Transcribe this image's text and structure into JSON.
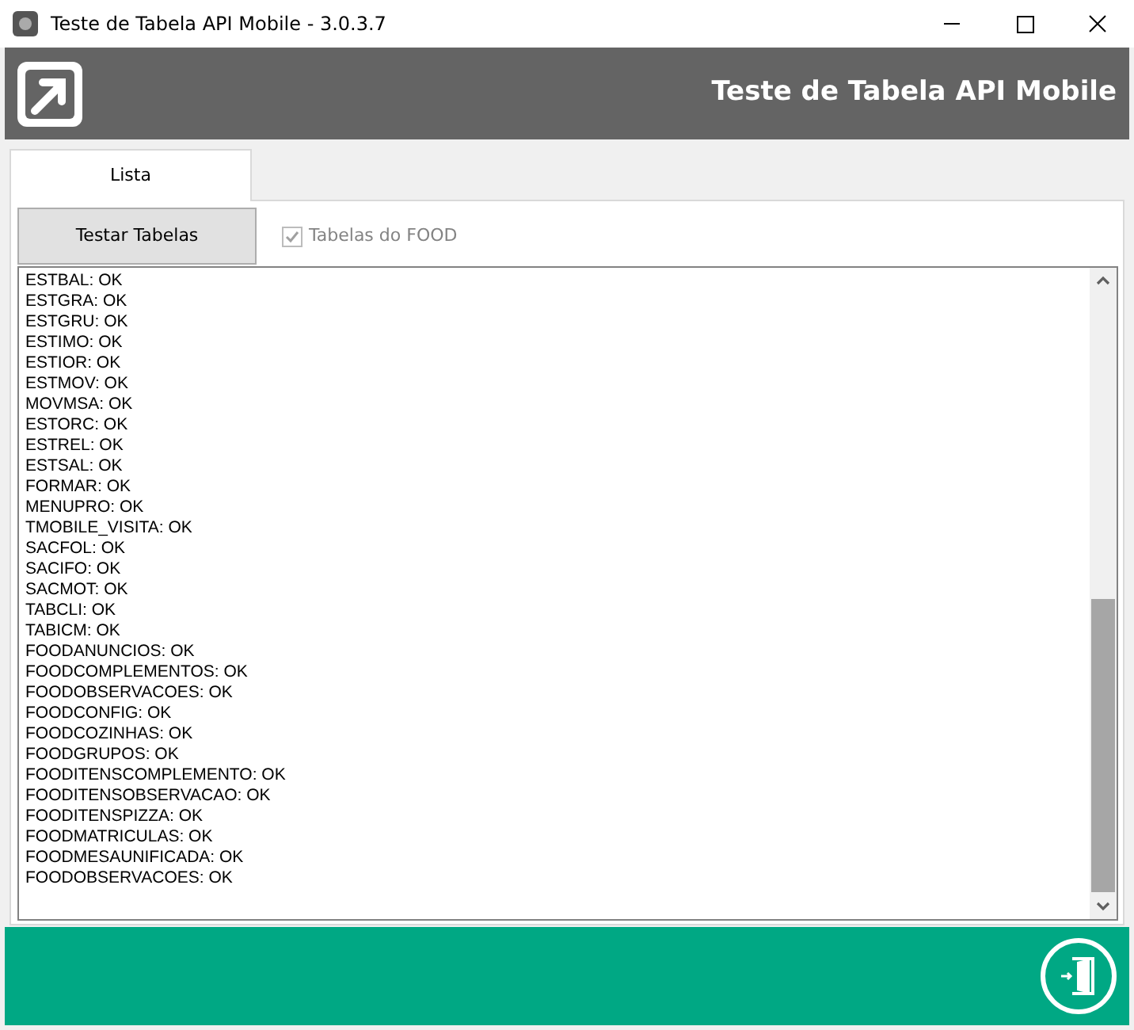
{
  "window": {
    "title": "Teste de Tabela API Mobile - 3.0.3.7"
  },
  "header": {
    "title": "Teste de Tabela API Mobile"
  },
  "tabs": [
    {
      "label": "Lista",
      "selected": true
    }
  ],
  "toolbar": {
    "button": "Testar Tabelas",
    "checkbox": {
      "label": "Tabelas do FOOD",
      "checked": true,
      "disabled": true
    }
  },
  "log_lines": [
    "ESTBAL: OK",
    "ESTGRA: OK",
    "ESTGRU: OK",
    "ESTIMO: OK",
    "ESTIOR: OK",
    "ESTMOV: OK",
    "MOVMSA: OK",
    "ESTORC: OK",
    "ESTREL: OK",
    "ESTSAL: OK",
    "FORMAR: OK",
    "MENUPRO: OK",
    "TMOBILE_VISITA: OK",
    "SACFOL: OK",
    "SACIFO: OK",
    "SACMOT: OK",
    "TABCLI: OK",
    "TABICM: OK",
    "FOODANUNCIOS: OK",
    "FOODCOMPLEMENTOS: OK",
    "FOODOBSERVACOES: OK",
    "FOODCONFIG: OK",
    "FOODCOZINHAS: OK",
    "FOODGRUPOS: OK",
    "FOODITENSCOMPLEMENTO: OK",
    "FOODITENSOBSERVACAO: OK",
    "FOODITENSPIZZA: OK",
    "FOODMATRICULAS: OK",
    "FOODMESAUNIFICADA: OK",
    "FOODOBSERVACOES: OK"
  ]
}
